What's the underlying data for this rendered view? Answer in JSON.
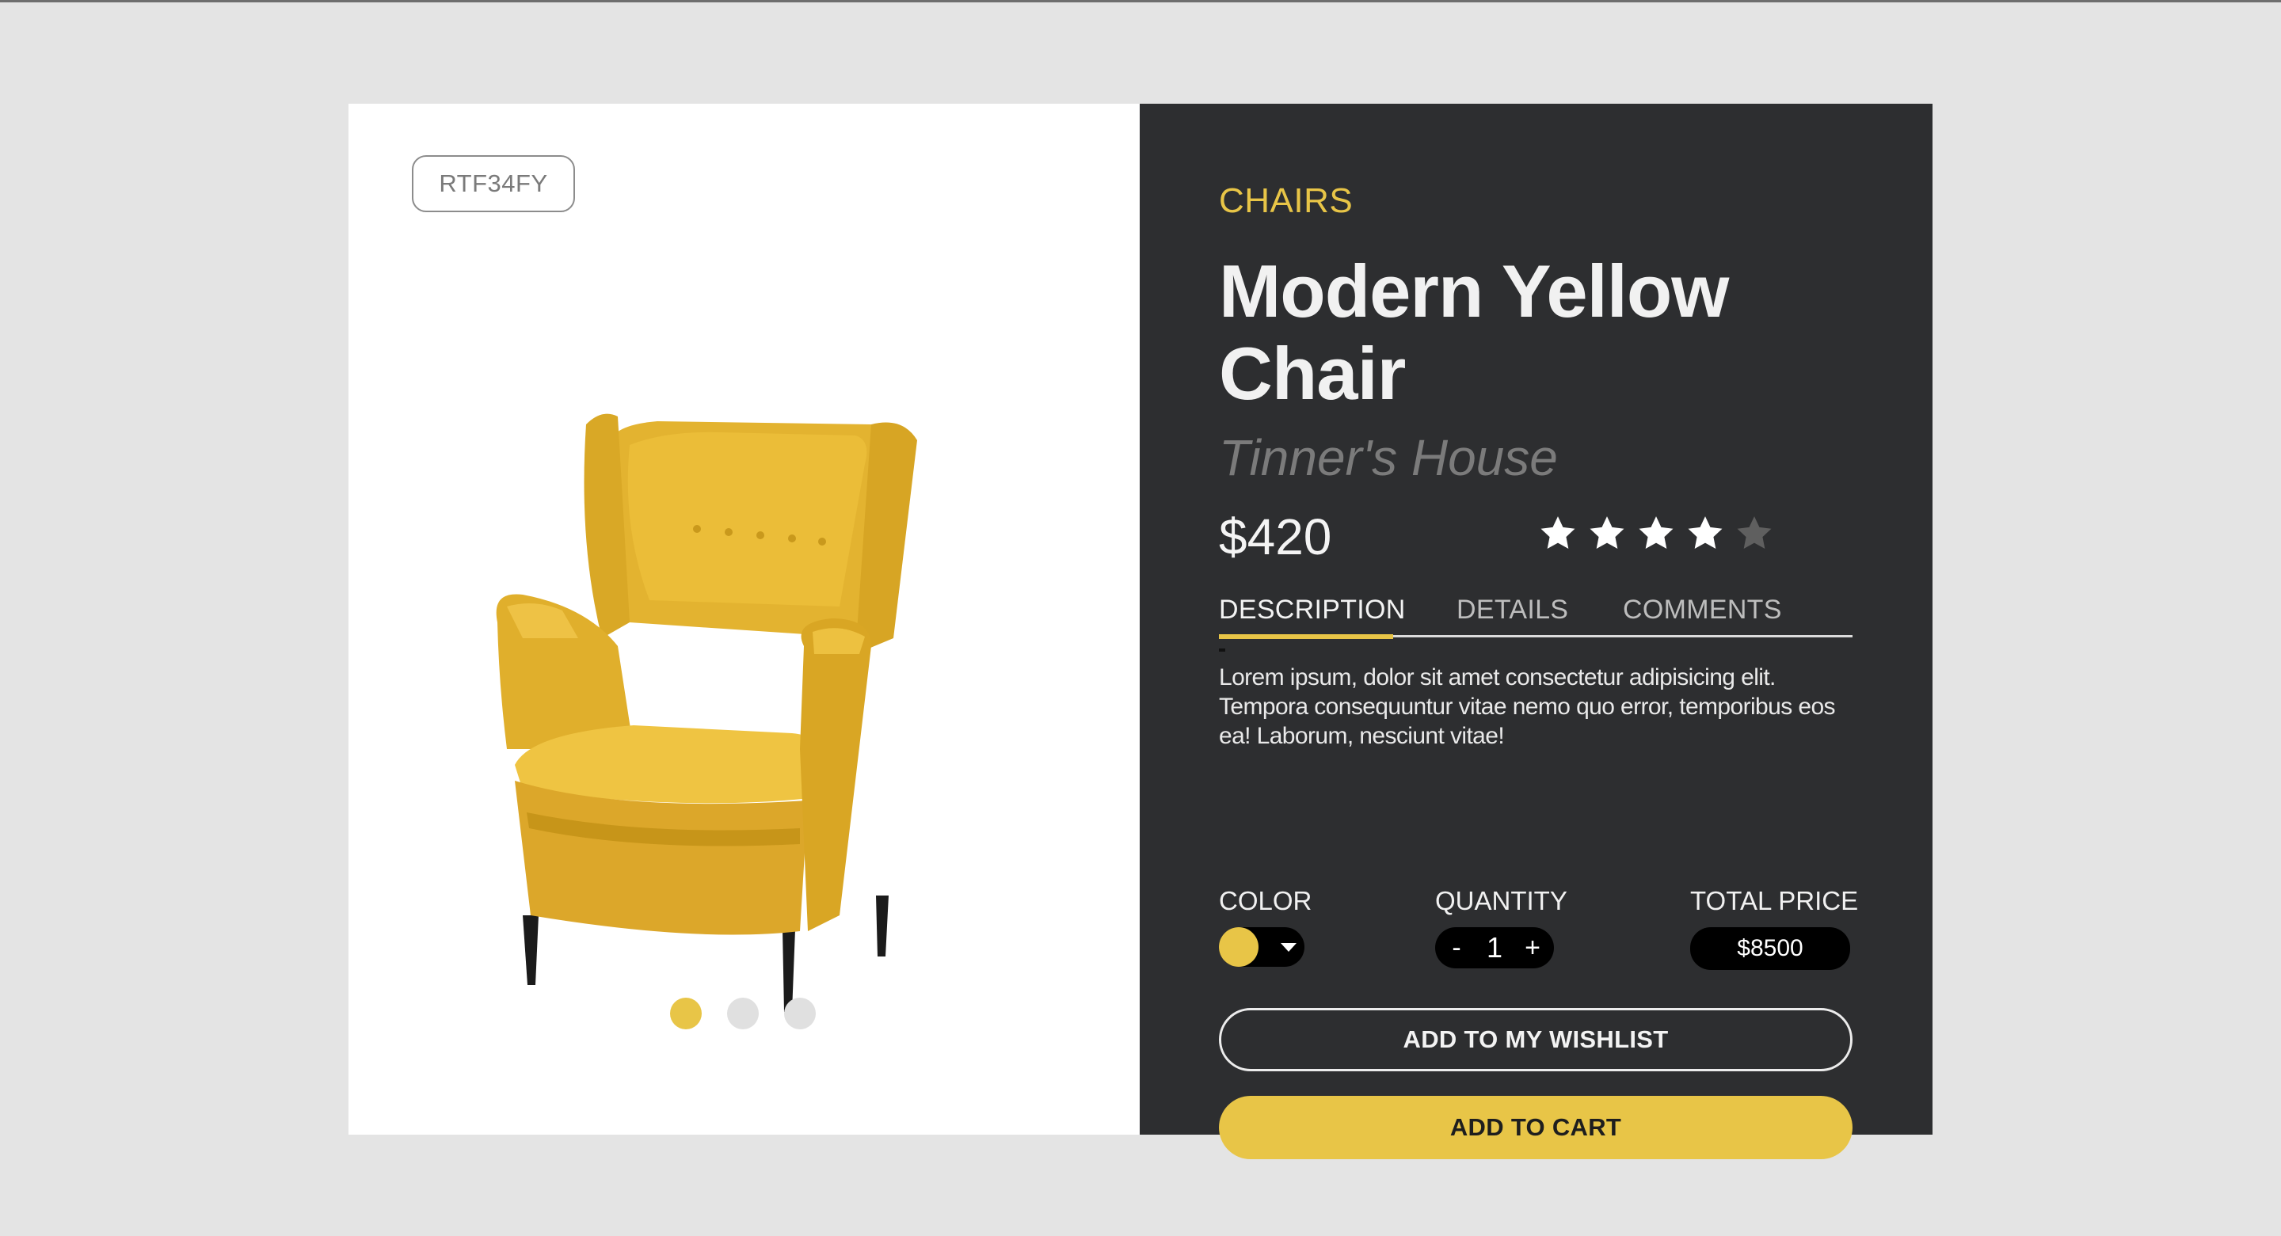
{
  "product": {
    "sku": "RTF34FY",
    "category": "CHAIRS",
    "title": "Modern Yellow Chair",
    "brand": "Tinner's House",
    "price": "$420",
    "rating": 4,
    "rating_max": 5,
    "description": "Lorem ipsum, dolor sit amet consectetur adipisicing elit. Tempora consequuntur vitae nemo quo error, temporibus eos ea! Laborum, nesciunt vitae!"
  },
  "gallery": {
    "image": "yellow-wingback-armchair",
    "dots": 3,
    "active_dot": 0
  },
  "tabs": [
    {
      "label": "DESCRIPTION"
    },
    {
      "label": "DETAILS"
    },
    {
      "label": "COMMENTS"
    }
  ],
  "options": {
    "color_label": "COLOR",
    "selected_color": "#e8c547",
    "quantity_label": "QUANTITY",
    "quantity_minus": "-",
    "quantity": "1",
    "quantity_plus": "+",
    "total_label": "TOTAL PRICE",
    "total": "$8500"
  },
  "actions": {
    "wishlist": "ADD TO MY WISHLIST",
    "cart": "ADD TO CART"
  },
  "colors": {
    "accent": "#e8c547",
    "panel_dark": "#2d2e30",
    "background": "#e4e4e4"
  }
}
